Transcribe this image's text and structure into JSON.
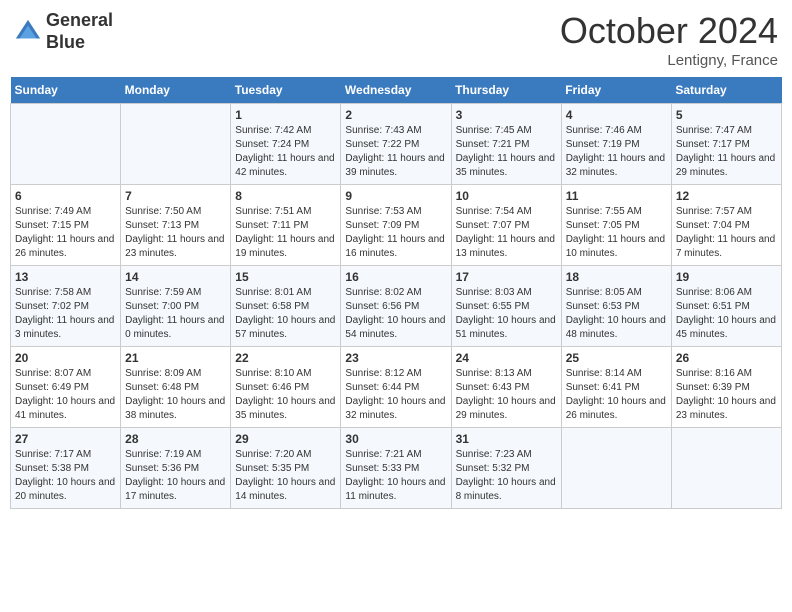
{
  "header": {
    "logo_line1": "General",
    "logo_line2": "Blue",
    "month": "October 2024",
    "location": "Lentigny, France"
  },
  "days_of_week": [
    "Sunday",
    "Monday",
    "Tuesday",
    "Wednesday",
    "Thursday",
    "Friday",
    "Saturday"
  ],
  "weeks": [
    [
      null,
      null,
      {
        "day": 1,
        "sunrise": "Sunrise: 7:42 AM",
        "sunset": "Sunset: 7:24 PM",
        "daylight": "Daylight: 11 hours and 42 minutes."
      },
      {
        "day": 2,
        "sunrise": "Sunrise: 7:43 AM",
        "sunset": "Sunset: 7:22 PM",
        "daylight": "Daylight: 11 hours and 39 minutes."
      },
      {
        "day": 3,
        "sunrise": "Sunrise: 7:45 AM",
        "sunset": "Sunset: 7:21 PM",
        "daylight": "Daylight: 11 hours and 35 minutes."
      },
      {
        "day": 4,
        "sunrise": "Sunrise: 7:46 AM",
        "sunset": "Sunset: 7:19 PM",
        "daylight": "Daylight: 11 hours and 32 minutes."
      },
      {
        "day": 5,
        "sunrise": "Sunrise: 7:47 AM",
        "sunset": "Sunset: 7:17 PM",
        "daylight": "Daylight: 11 hours and 29 minutes."
      }
    ],
    [
      {
        "day": 6,
        "sunrise": "Sunrise: 7:49 AM",
        "sunset": "Sunset: 7:15 PM",
        "daylight": "Daylight: 11 hours and 26 minutes."
      },
      {
        "day": 7,
        "sunrise": "Sunrise: 7:50 AM",
        "sunset": "Sunset: 7:13 PM",
        "daylight": "Daylight: 11 hours and 23 minutes."
      },
      {
        "day": 8,
        "sunrise": "Sunrise: 7:51 AM",
        "sunset": "Sunset: 7:11 PM",
        "daylight": "Daylight: 11 hours and 19 minutes."
      },
      {
        "day": 9,
        "sunrise": "Sunrise: 7:53 AM",
        "sunset": "Sunset: 7:09 PM",
        "daylight": "Daylight: 11 hours and 16 minutes."
      },
      {
        "day": 10,
        "sunrise": "Sunrise: 7:54 AM",
        "sunset": "Sunset: 7:07 PM",
        "daylight": "Daylight: 11 hours and 13 minutes."
      },
      {
        "day": 11,
        "sunrise": "Sunrise: 7:55 AM",
        "sunset": "Sunset: 7:05 PM",
        "daylight": "Daylight: 11 hours and 10 minutes."
      },
      {
        "day": 12,
        "sunrise": "Sunrise: 7:57 AM",
        "sunset": "Sunset: 7:04 PM",
        "daylight": "Daylight: 11 hours and 7 minutes."
      }
    ],
    [
      {
        "day": 13,
        "sunrise": "Sunrise: 7:58 AM",
        "sunset": "Sunset: 7:02 PM",
        "daylight": "Daylight: 11 hours and 3 minutes."
      },
      {
        "day": 14,
        "sunrise": "Sunrise: 7:59 AM",
        "sunset": "Sunset: 7:00 PM",
        "daylight": "Daylight: 11 hours and 0 minutes."
      },
      {
        "day": 15,
        "sunrise": "Sunrise: 8:01 AM",
        "sunset": "Sunset: 6:58 PM",
        "daylight": "Daylight: 10 hours and 57 minutes."
      },
      {
        "day": 16,
        "sunrise": "Sunrise: 8:02 AM",
        "sunset": "Sunset: 6:56 PM",
        "daylight": "Daylight: 10 hours and 54 minutes."
      },
      {
        "day": 17,
        "sunrise": "Sunrise: 8:03 AM",
        "sunset": "Sunset: 6:55 PM",
        "daylight": "Daylight: 10 hours and 51 minutes."
      },
      {
        "day": 18,
        "sunrise": "Sunrise: 8:05 AM",
        "sunset": "Sunset: 6:53 PM",
        "daylight": "Daylight: 10 hours and 48 minutes."
      },
      {
        "day": 19,
        "sunrise": "Sunrise: 8:06 AM",
        "sunset": "Sunset: 6:51 PM",
        "daylight": "Daylight: 10 hours and 45 minutes."
      }
    ],
    [
      {
        "day": 20,
        "sunrise": "Sunrise: 8:07 AM",
        "sunset": "Sunset: 6:49 PM",
        "daylight": "Daylight: 10 hours and 41 minutes."
      },
      {
        "day": 21,
        "sunrise": "Sunrise: 8:09 AM",
        "sunset": "Sunset: 6:48 PM",
        "daylight": "Daylight: 10 hours and 38 minutes."
      },
      {
        "day": 22,
        "sunrise": "Sunrise: 8:10 AM",
        "sunset": "Sunset: 6:46 PM",
        "daylight": "Daylight: 10 hours and 35 minutes."
      },
      {
        "day": 23,
        "sunrise": "Sunrise: 8:12 AM",
        "sunset": "Sunset: 6:44 PM",
        "daylight": "Daylight: 10 hours and 32 minutes."
      },
      {
        "day": 24,
        "sunrise": "Sunrise: 8:13 AM",
        "sunset": "Sunset: 6:43 PM",
        "daylight": "Daylight: 10 hours and 29 minutes."
      },
      {
        "day": 25,
        "sunrise": "Sunrise: 8:14 AM",
        "sunset": "Sunset: 6:41 PM",
        "daylight": "Daylight: 10 hours and 26 minutes."
      },
      {
        "day": 26,
        "sunrise": "Sunrise: 8:16 AM",
        "sunset": "Sunset: 6:39 PM",
        "daylight": "Daylight: 10 hours and 23 minutes."
      }
    ],
    [
      {
        "day": 27,
        "sunrise": "Sunrise: 7:17 AM",
        "sunset": "Sunset: 5:38 PM",
        "daylight": "Daylight: 10 hours and 20 minutes."
      },
      {
        "day": 28,
        "sunrise": "Sunrise: 7:19 AM",
        "sunset": "Sunset: 5:36 PM",
        "daylight": "Daylight: 10 hours and 17 minutes."
      },
      {
        "day": 29,
        "sunrise": "Sunrise: 7:20 AM",
        "sunset": "Sunset: 5:35 PM",
        "daylight": "Daylight: 10 hours and 14 minutes."
      },
      {
        "day": 30,
        "sunrise": "Sunrise: 7:21 AM",
        "sunset": "Sunset: 5:33 PM",
        "daylight": "Daylight: 10 hours and 11 minutes."
      },
      {
        "day": 31,
        "sunrise": "Sunrise: 7:23 AM",
        "sunset": "Sunset: 5:32 PM",
        "daylight": "Daylight: 10 hours and 8 minutes."
      },
      null,
      null
    ]
  ]
}
